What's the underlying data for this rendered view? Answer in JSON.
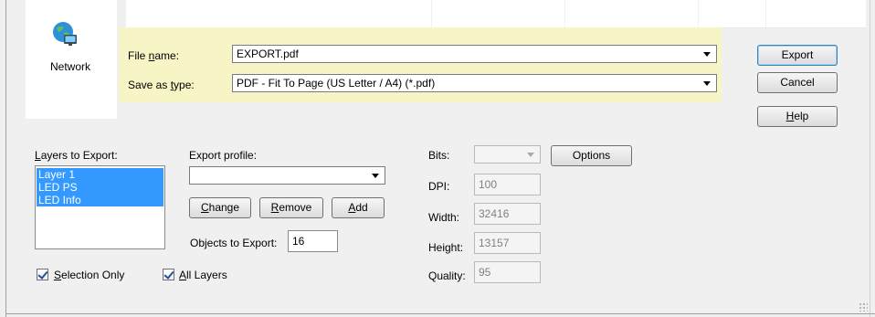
{
  "places": {
    "network_label": "Network"
  },
  "file_name": {
    "label_pre": "File ",
    "label_key": "n",
    "label_post": "ame:",
    "value": "EXPORT.pdf"
  },
  "save_as_type": {
    "label_pre": "Save as ",
    "label_key": "t",
    "label_post": "ype:",
    "value": "PDF - Fit To Page (US Letter / A4) (*.pdf)"
  },
  "buttons": {
    "export": "Export",
    "cancel": "Cancel",
    "help_key": "H",
    "help_rest": "elp"
  },
  "layers": {
    "label_key": "L",
    "label_rest": "ayers to Export:",
    "items": [
      "Layer 1",
      "LED PS",
      "LED Info"
    ]
  },
  "export_profile": {
    "label": "Export profile:",
    "value": "",
    "change_key": "C",
    "change_rest": "hange",
    "remove_key": "R",
    "remove_rest": "emove",
    "add_key": "A",
    "add_rest": "dd"
  },
  "objects_to_export": {
    "label": "Objects to Export:",
    "value": "16"
  },
  "bits": {
    "label": "Bits:",
    "value": ""
  },
  "options_button": "Options",
  "dpi": {
    "label": "DPI:",
    "value": "100"
  },
  "width": {
    "label": "Width:",
    "value": "32416"
  },
  "height": {
    "label": "Height:",
    "value": "13157"
  },
  "quality": {
    "label": "Quality:",
    "value": "95"
  },
  "selection_only": {
    "key": "S",
    "rest": "election Only",
    "checked": true
  },
  "all_layers": {
    "key": "A",
    "rest": "ll Layers",
    "checked": true
  }
}
